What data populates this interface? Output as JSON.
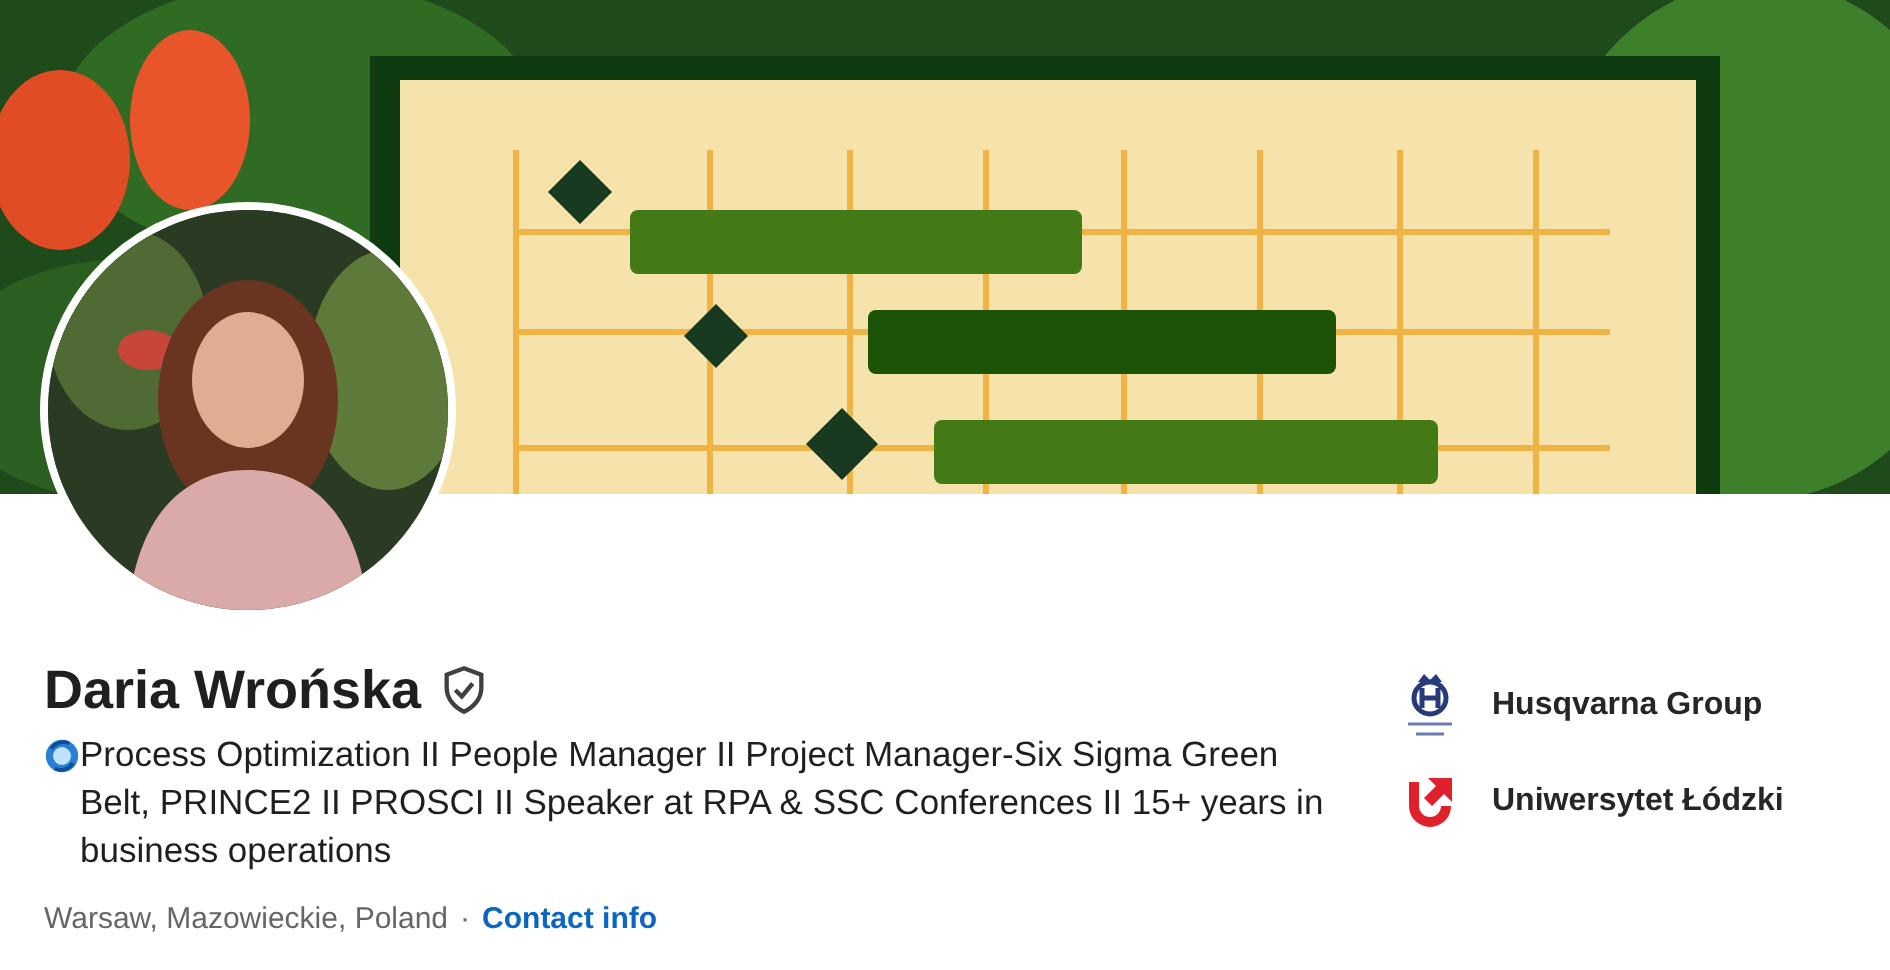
{
  "profile": {
    "name": "Daria Wrońska",
    "verified": true,
    "headline": "Process Optimization II People Manager II Project Manager-Six Sigma Green Belt, PRINCE2 II PROSCI II Speaker at RPA & SSC Conferences II 15+ years in business operations",
    "location": "Warsaw, Mazowieckie, Poland",
    "separator": "·",
    "contact_link": "Contact info"
  },
  "affiliations": [
    {
      "name": "Husqvarna Group",
      "kind": "company"
    },
    {
      "name": "Uniwersytet Łódzki",
      "kind": "university"
    }
  ]
}
